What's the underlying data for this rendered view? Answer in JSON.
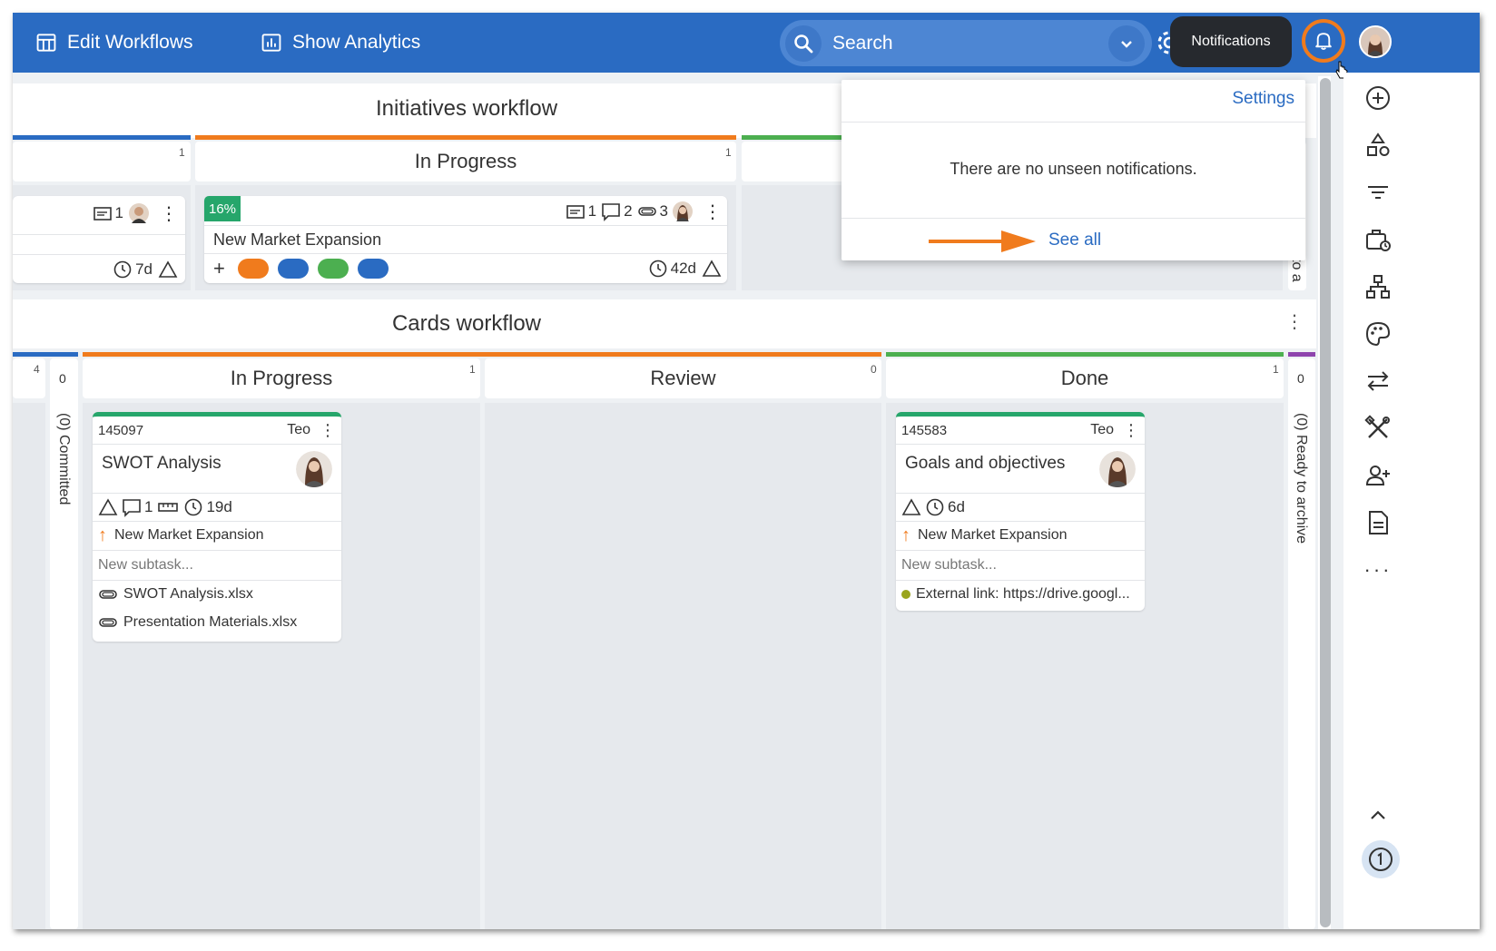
{
  "topbar": {
    "edit_workflows": "Edit Workflows",
    "show_analytics": "Show Analytics",
    "search_placeholder": "Search",
    "tooltip": "Notifications"
  },
  "notifications": {
    "settings": "Settings",
    "empty_message": "There are no unseen notifications.",
    "see_all": "See all"
  },
  "initiatives": {
    "title": "Initiatives workflow",
    "columns": [
      {
        "count": "1",
        "color": "#2a6bc2"
      },
      {
        "label": "In Progress",
        "count": "1",
        "color": "#f07b1d"
      },
      {
        "color": "#4caf50"
      }
    ],
    "left_card": {
      "comments": "1",
      "due": "7d"
    },
    "card": {
      "progress": "16%",
      "title": "New Market Expansion",
      "notes": "1",
      "comments": "2",
      "attachments": "3",
      "due": "42d",
      "tag_colors": [
        "#f07b1d",
        "#2a6bc2",
        "#4caf50",
        "#2a6bc2"
      ]
    },
    "right_vertical": "to a"
  },
  "cards": {
    "title": "Cards workflow",
    "columns": [
      {
        "count": "4",
        "color": "#2a6bc2"
      },
      {
        "vertical": "(0) Committed",
        "count": "0"
      },
      {
        "label": "In Progress",
        "count": "1",
        "color": "#f07b1d"
      },
      {
        "label": "Review",
        "count": "0",
        "color": "#f07b1d"
      },
      {
        "label": "Done",
        "count": "1",
        "color": "#4caf50"
      },
      {
        "vertical": "(0) Ready to archive",
        "count": "0",
        "color": "#8e44ad"
      }
    ],
    "card1": {
      "id": "145097",
      "owner": "Teo",
      "title": "SWOT Analysis",
      "comments": "1",
      "due": "19d",
      "parent": "New Market Expansion",
      "subtask_placeholder": "New subtask...",
      "attachments": [
        "SWOT Analysis.xlsx",
        "Presentation Materials.xlsx"
      ]
    },
    "card2": {
      "id": "145583",
      "owner": "Teo",
      "title": "Goals and objectives",
      "due": "6d",
      "parent": "New Market Expansion",
      "subtask_placeholder": "New subtask...",
      "link": "External link: https://drive.googl..."
    }
  },
  "colors": {
    "brand": "#2a6bc2",
    "accent": "#f07b1d",
    "done": "#4caf50",
    "progress_badge": "#26a66b"
  }
}
